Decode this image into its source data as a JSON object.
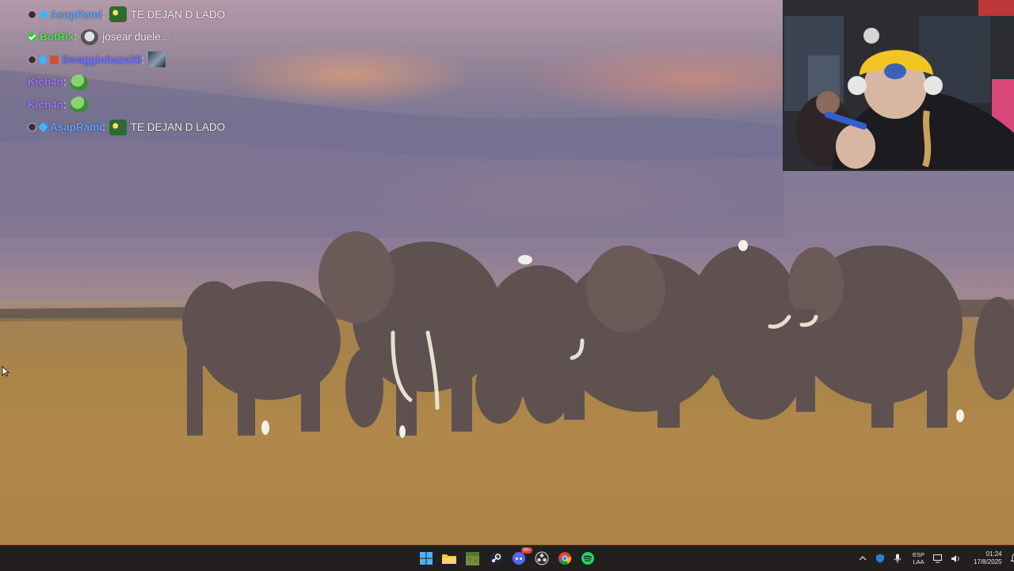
{
  "chat": {
    "messages": [
      {
        "username": "AsapRami",
        "text": "TE DEJAN D LADO"
      },
      {
        "username": "BotRix",
        "text": "josear duele..."
      },
      {
        "username": "Swagginhaze28",
        "text": ""
      },
      {
        "username": "Kich4n",
        "text": ""
      },
      {
        "username": "Kich4n",
        "text": ""
      },
      {
        "username": "AsapRami",
        "text": "TE DEJAN D LADO"
      }
    ]
  },
  "taskbar": {
    "apps": [
      "start-icon",
      "file-explorer-icon",
      "minecraft-icon",
      "steam-icon",
      "discord-icon",
      "obs-icon",
      "chrome-icon",
      "spotify-icon"
    ],
    "discord_badge": "99+",
    "language": "ESP",
    "layout": "LAA",
    "time": "01:24",
    "date": "17/8/2025"
  },
  "colors": {
    "taskbar_bg": "#221f1e",
    "username_asap": "#5aa1ff",
    "username_botrix": "#4ee04e",
    "username_kich": "#9d72f0"
  }
}
